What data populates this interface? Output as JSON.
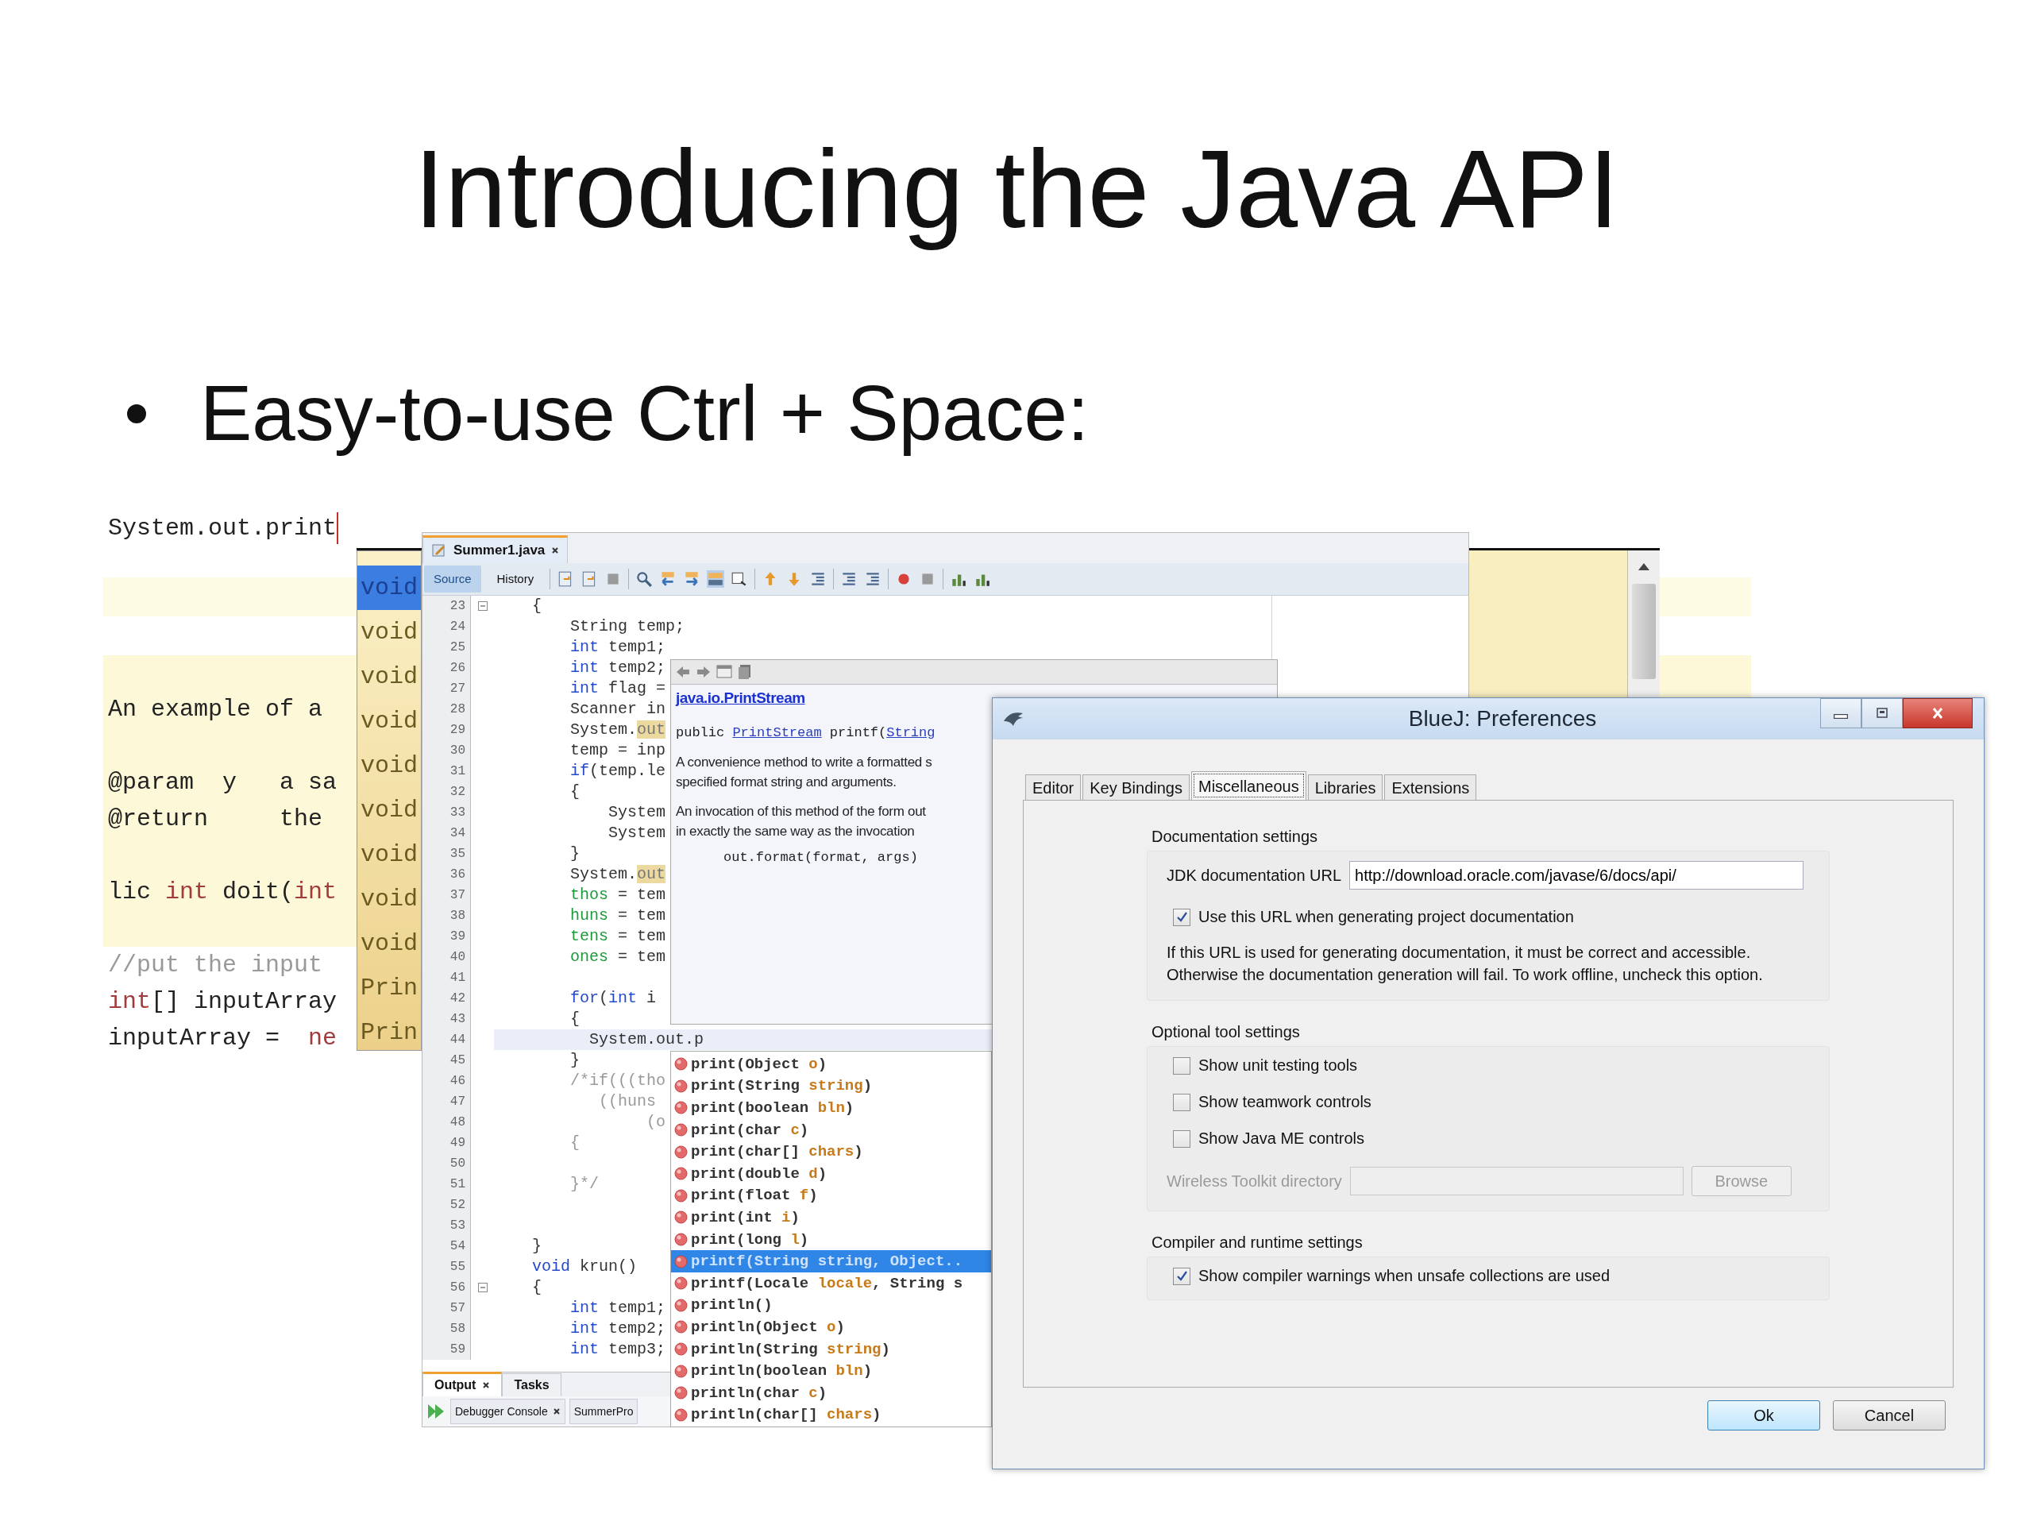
{
  "slide": {
    "title": "Introducing the Java API",
    "bullets": [
      "Easy-to-use Ctrl + Space:"
    ]
  },
  "bluej_editor": {
    "typed": "System.out.print",
    "lines": [
      {
        "parts": [
          {
            "text": "An example of a",
            "kind": "plain"
          }
        ]
      },
      {
        "parts": [
          {
            "text": "@param  y   a sa",
            "kind": "plain"
          }
        ]
      },
      {
        "parts": [
          {
            "text": "@return     the",
            "kind": "plain"
          }
        ]
      },
      {
        "parts": [
          {
            "text": "lic ",
            "kind": "plain"
          },
          {
            "text": "int",
            "kind": "keyword"
          },
          {
            "text": " doit(",
            "kind": "plain"
          },
          {
            "text": "int",
            "kind": "keyword"
          }
        ]
      },
      {
        "parts": [
          {
            "text": "//put the input",
            "kind": "comment"
          }
        ]
      },
      {
        "parts": [
          {
            "text": "int",
            "kind": "keyword"
          },
          {
            "text": "[] inputArray",
            "kind": "plain"
          }
        ]
      },
      {
        "parts": [
          {
            "text": "inputArray =  ",
            "kind": "plain"
          },
          {
            "text": "ne",
            "kind": "keyword"
          }
        ]
      }
    ]
  },
  "bluej_completion": {
    "items": [
      {
        "text": "void",
        "selected": true
      },
      {
        "text": "void",
        "selected": false
      },
      {
        "text": "void",
        "selected": false
      },
      {
        "text": "void",
        "selected": false
      },
      {
        "text": "void",
        "selected": false
      },
      {
        "text": "void",
        "selected": false
      },
      {
        "text": "void",
        "selected": false
      },
      {
        "text": "void",
        "selected": false
      },
      {
        "text": "void",
        "selected": false
      },
      {
        "text": "Prin",
        "selected": false
      },
      {
        "text": "Prin",
        "selected": false
      }
    ]
  },
  "netbeans": {
    "file_tabs": [
      {
        "label": "Summer1.java",
        "selected": true,
        "closable": true
      }
    ],
    "view_tabs": [
      {
        "label": "Source",
        "selected": true
      },
      {
        "label": "History",
        "selected": false
      }
    ],
    "lines": [
      {
        "number": "23",
        "fold": true,
        "current": false,
        "parts": [
          {
            "text": "    {",
            "kind": "plain"
          }
        ]
      },
      {
        "number": "24",
        "fold": false,
        "current": false,
        "parts": [
          {
            "text": "        String temp;",
            "kind": "plain"
          }
        ]
      },
      {
        "number": "25",
        "fold": false,
        "current": false,
        "parts": [
          {
            "text": "        int",
            "kind": "keyword"
          },
          {
            "text": " temp1;",
            "kind": "plain"
          }
        ]
      },
      {
        "number": "26",
        "fold": false,
        "current": false,
        "parts": [
          {
            "text": "        int",
            "kind": "keyword"
          },
          {
            "text": " temp2;",
            "kind": "plain"
          }
        ]
      },
      {
        "number": "27",
        "fold": false,
        "current": false,
        "parts": [
          {
            "text": "        int",
            "kind": "keyword"
          },
          {
            "text": " flag =",
            "kind": "plain"
          }
        ]
      },
      {
        "number": "28",
        "fold": false,
        "current": false,
        "parts": [
          {
            "text": "        Scanner in",
            "kind": "plain"
          }
        ]
      },
      {
        "number": "29",
        "fold": false,
        "current": false,
        "parts": [
          {
            "text": "        System.",
            "kind": "plain"
          },
          {
            "text": "out",
            "kind": "mark"
          }
        ]
      },
      {
        "number": "30",
        "fold": false,
        "current": false,
        "parts": [
          {
            "text": "        temp = inp",
            "kind": "plain"
          }
        ]
      },
      {
        "number": "31",
        "fold": false,
        "current": false,
        "parts": [
          {
            "text": "        if",
            "kind": "keyword"
          },
          {
            "text": "(temp.le",
            "kind": "plain"
          }
        ]
      },
      {
        "number": "32",
        "fold": false,
        "current": false,
        "parts": [
          {
            "text": "        {",
            "kind": "plain"
          }
        ]
      },
      {
        "number": "33",
        "fold": false,
        "current": false,
        "parts": [
          {
            "text": "            System",
            "kind": "plain"
          }
        ]
      },
      {
        "number": "34",
        "fold": false,
        "current": false,
        "parts": [
          {
            "text": "            System",
            "kind": "plain"
          }
        ]
      },
      {
        "number": "35",
        "fold": false,
        "current": false,
        "parts": [
          {
            "text": "        }",
            "kind": "plain"
          }
        ]
      },
      {
        "number": "36",
        "fold": false,
        "current": false,
        "parts": [
          {
            "text": "        System.",
            "kind": "plain"
          },
          {
            "text": "out",
            "kind": "mark"
          }
        ]
      },
      {
        "number": "37",
        "fold": false,
        "current": false,
        "parts": [
          {
            "text": "        thos",
            "kind": "field"
          },
          {
            "text": " = tem",
            "kind": "plain"
          }
        ]
      },
      {
        "number": "38",
        "fold": false,
        "current": false,
        "parts": [
          {
            "text": "        huns",
            "kind": "field"
          },
          {
            "text": " = tem",
            "kind": "plain"
          }
        ]
      },
      {
        "number": "39",
        "fold": false,
        "current": false,
        "parts": [
          {
            "text": "        tens",
            "kind": "field"
          },
          {
            "text": " = tem",
            "kind": "plain"
          }
        ]
      },
      {
        "number": "40",
        "fold": false,
        "current": false,
        "parts": [
          {
            "text": "        ones",
            "kind": "field"
          },
          {
            "text": " = tem",
            "kind": "plain"
          }
        ]
      },
      {
        "number": "41",
        "fold": false,
        "current": false
      },
      {
        "number": "42",
        "fold": false,
        "current": false,
        "parts": [
          {
            "text": "        for",
            "kind": "keyword"
          },
          {
            "text": "(",
            "kind": "plain"
          },
          {
            "text": "int",
            "kind": "keyword"
          },
          {
            "text": " i",
            "kind": "plain"
          }
        ]
      },
      {
        "number": "43",
        "fold": false,
        "current": false,
        "parts": [
          {
            "text": "        {",
            "kind": "plain"
          }
        ]
      },
      {
        "number": "44",
        "fold": false,
        "current": true,
        "parts": [
          {
            "text": "          System.out.p",
            "kind": "plain"
          }
        ]
      },
      {
        "number": "45",
        "fold": false,
        "current": false,
        "parts": [
          {
            "text": "        }",
            "kind": "plain"
          }
        ]
      },
      {
        "number": "46",
        "fold": false,
        "current": false,
        "parts": [
          {
            "text": "        /*if(((tho",
            "kind": "comment"
          }
        ]
      },
      {
        "number": "47",
        "fold": false,
        "current": false,
        "parts": [
          {
            "text": "           ((huns",
            "kind": "comment"
          }
        ]
      },
      {
        "number": "48",
        "fold": false,
        "current": false,
        "parts": [
          {
            "text": "                (o",
            "kind": "comment"
          }
        ]
      },
      {
        "number": "49",
        "fold": false,
        "current": false,
        "parts": [
          {
            "text": "        {",
            "kind": "comment"
          }
        ]
      },
      {
        "number": "50",
        "fold": false,
        "current": false
      },
      {
        "number": "51",
        "fold": false,
        "current": false,
        "parts": [
          {
            "text": "        }*/",
            "kind": "comment"
          }
        ]
      },
      {
        "number": "52",
        "fold": false,
        "current": false
      },
      {
        "number": "53",
        "fold": false,
        "current": false
      },
      {
        "number": "54",
        "fold": false,
        "current": false,
        "parts": [
          {
            "text": "    }",
            "kind": "plain"
          }
        ]
      },
      {
        "number": "55",
        "fold": false,
        "current": false,
        "parts": [
          {
            "text": "    void",
            "kind": "keyword"
          },
          {
            "text": " krun()",
            "kind": "plain"
          }
        ]
      },
      {
        "number": "56",
        "fold": true,
        "current": false,
        "parts": [
          {
            "text": "    {",
            "kind": "plain"
          }
        ]
      },
      {
        "number": "57",
        "fold": false,
        "current": false,
        "parts": [
          {
            "text": "        int",
            "kind": "keyword"
          },
          {
            "text": " temp1;",
            "kind": "plain"
          }
        ]
      },
      {
        "number": "58",
        "fold": false,
        "current": false,
        "parts": [
          {
            "text": "        int",
            "kind": "keyword"
          },
          {
            "text": " temp2;",
            "kind": "plain"
          }
        ]
      },
      {
        "number": "59",
        "fold": false,
        "current": false,
        "parts": [
          {
            "text": "        int",
            "kind": "keyword"
          },
          {
            "text": " temp3;",
            "kind": "plain"
          }
        ]
      }
    ],
    "bottom_tabs": [
      {
        "label": "Output",
        "selected": true,
        "closable": true
      },
      {
        "label": "Tasks",
        "selected": false,
        "closable": false
      }
    ],
    "console_tabs": [
      {
        "label": "Debugger Console",
        "closable": true
      },
      {
        "label": "SummerPro",
        "closable": false
      }
    ]
  },
  "javadoc": {
    "heading": "java.io.PrintStream",
    "signature": [
      {
        "text": "public ",
        "kind": "plain"
      },
      {
        "text": "PrintStream",
        "kind": "link"
      },
      {
        "text": " printf(",
        "kind": "plain"
      },
      {
        "text": "String",
        "kind": "link"
      }
    ],
    "paragraphs": [
      [
        "A convenience method to write a formatted s",
        "specified format string and arguments."
      ],
      [
        "An invocation of this method of the form out",
        "in exactly the same way as the invocation"
      ]
    ],
    "example": "out.format(format, args)"
  },
  "completion": {
    "items": [
      {
        "selected": false,
        "parts": [
          {
            "text": "print(Object ",
            "kind": "plain"
          },
          {
            "text": "o",
            "kind": "param"
          },
          {
            "text": ")",
            "kind": "plain"
          }
        ]
      },
      {
        "selected": false,
        "parts": [
          {
            "text": "print(String ",
            "kind": "plain"
          },
          {
            "text": "string",
            "kind": "param"
          },
          {
            "text": ")",
            "kind": "plain"
          }
        ]
      },
      {
        "selected": false,
        "parts": [
          {
            "text": "print(boolean ",
            "kind": "plain"
          },
          {
            "text": "bln",
            "kind": "param"
          },
          {
            "text": ")",
            "kind": "plain"
          }
        ]
      },
      {
        "selected": false,
        "parts": [
          {
            "text": "print(char ",
            "kind": "plain"
          },
          {
            "text": "c",
            "kind": "param"
          },
          {
            "text": ")",
            "kind": "plain"
          }
        ]
      },
      {
        "selected": false,
        "parts": [
          {
            "text": "print(char[] ",
            "kind": "plain"
          },
          {
            "text": "chars",
            "kind": "param"
          },
          {
            "text": ")",
            "kind": "plain"
          }
        ]
      },
      {
        "selected": false,
        "parts": [
          {
            "text": "print(double ",
            "kind": "plain"
          },
          {
            "text": "d",
            "kind": "param"
          },
          {
            "text": ")",
            "kind": "plain"
          }
        ]
      },
      {
        "selected": false,
        "parts": [
          {
            "text": "print(float ",
            "kind": "plain"
          },
          {
            "text": "f",
            "kind": "param"
          },
          {
            "text": ")",
            "kind": "plain"
          }
        ]
      },
      {
        "selected": false,
        "parts": [
          {
            "text": "print(int ",
            "kind": "plain"
          },
          {
            "text": "i",
            "kind": "param"
          },
          {
            "text": ")",
            "kind": "plain"
          }
        ]
      },
      {
        "selected": false,
        "parts": [
          {
            "text": "print(long ",
            "kind": "plain"
          },
          {
            "text": "l",
            "kind": "param"
          },
          {
            "text": ")",
            "kind": "plain"
          }
        ]
      },
      {
        "selected": true,
        "parts": [
          {
            "text": "printf(String ",
            "kind": "plain"
          },
          {
            "text": "string",
            "kind": "param"
          },
          {
            "text": ", Object..",
            "kind": "plain"
          }
        ]
      },
      {
        "selected": false,
        "parts": [
          {
            "text": "printf(Locale ",
            "kind": "plain"
          },
          {
            "text": "locale",
            "kind": "param"
          },
          {
            "text": ", String s",
            "kind": "plain"
          }
        ]
      },
      {
        "selected": false,
        "parts": [
          {
            "text": "println()",
            "kind": "plain"
          }
        ]
      },
      {
        "selected": false,
        "parts": [
          {
            "text": "println(Object ",
            "kind": "plain"
          },
          {
            "text": "o",
            "kind": "param"
          },
          {
            "text": ")",
            "kind": "plain"
          }
        ]
      },
      {
        "selected": false,
        "parts": [
          {
            "text": "println(String ",
            "kind": "plain"
          },
          {
            "text": "string",
            "kind": "param"
          },
          {
            "text": ")",
            "kind": "plain"
          }
        ]
      },
      {
        "selected": false,
        "parts": [
          {
            "text": "println(boolean ",
            "kind": "plain"
          },
          {
            "text": "bln",
            "kind": "param"
          },
          {
            "text": ")",
            "kind": "plain"
          }
        ]
      },
      {
        "selected": false,
        "parts": [
          {
            "text": "println(char ",
            "kind": "plain"
          },
          {
            "text": "c",
            "kind": "param"
          },
          {
            "text": ")",
            "kind": "plain"
          }
        ]
      },
      {
        "selected": false,
        "parts": [
          {
            "text": "println(char[] ",
            "kind": "plain"
          },
          {
            "text": "chars",
            "kind": "param"
          },
          {
            "text": ")",
            "kind": "plain"
          }
        ]
      }
    ]
  },
  "dialog": {
    "title": "BlueJ: Preferences",
    "tabs": [
      {
        "label": "Editor",
        "selected": false
      },
      {
        "label": "Key Bindings",
        "selected": false
      },
      {
        "label": "Miscellaneous",
        "selected": true
      },
      {
        "label": "Libraries",
        "selected": false
      },
      {
        "label": "Extensions",
        "selected": false
      }
    ],
    "sections": [
      {
        "title": "Documentation settings",
        "items": [
          {
            "kind": "field",
            "label": "JDK documentation URL",
            "value": "http://download.oracle.com/javase/6/docs/api/"
          },
          {
            "kind": "checkbox",
            "label": "Use this URL when generating project documentation",
            "checked": true
          },
          {
            "kind": "note",
            "lines": [
              "If this URL is used for generating documentation, it must be correct and accessible.",
              "Otherwise the documentation generation will fail. To work offline, uncheck this option."
            ]
          }
        ]
      },
      {
        "title": "Optional tool settings",
        "items": [
          {
            "kind": "checkbox",
            "label": "Show unit testing tools",
            "checked": false
          },
          {
            "kind": "checkbox",
            "label": "Show teamwork controls",
            "checked": false
          },
          {
            "kind": "checkbox",
            "label": "Show Java ME controls",
            "checked": false
          },
          {
            "kind": "path",
            "label": "Wireless Toolkit directory",
            "button": "Browse",
            "disabled": true
          }
        ]
      },
      {
        "title": "Compiler and runtime settings",
        "items": [
          {
            "kind": "checkbox",
            "label": "Show compiler warnings when unsafe collections are used",
            "checked": true
          }
        ]
      }
    ],
    "buttons": [
      {
        "label": "Ok",
        "default": true
      },
      {
        "label": "Cancel",
        "default": false
      }
    ]
  }
}
